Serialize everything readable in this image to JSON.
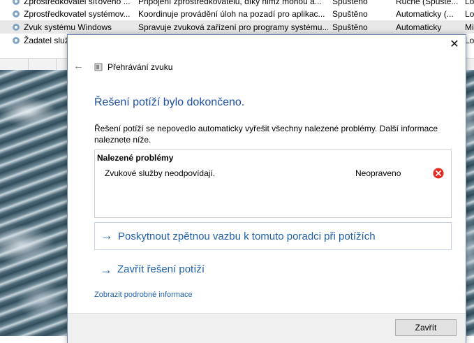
{
  "services": {
    "rows": [
      {
        "name": "Zprostředkovatel síťového ...",
        "description": "Připojení zprostředkovatelů, díky nimž mohou a...",
        "status": "Spuštěno",
        "startup": "Ručně (Spuště...",
        "logon": "Lo",
        "selected": false
      },
      {
        "name": "Zprostředkovatel systémov...",
        "description": "Koordinuje provádění úloh na pozadí pro aplikac...",
        "status": "Spuštěno",
        "startup": "Automaticky (...",
        "logon": "Lo",
        "selected": false
      },
      {
        "name": "Zvuk systému Windows",
        "description": "Spravuje zvuková zařízení pro programy systému...",
        "status": "Spuštěno",
        "startup": "Automaticky",
        "logon": "Mi",
        "selected": true
      },
      {
        "name": "Žadatel služ...",
        "description": "",
        "status": "",
        "startup": "",
        "logon": "Lo",
        "selected": false
      }
    ]
  },
  "dialog": {
    "close_glyph": "✕",
    "back_glyph": "←",
    "app_title": "Přehrávání zvuku",
    "heading": "Řešení potíží bylo dokončeno.",
    "description": "Řešení potíží se nepovedlo automaticky vyřešit všechny nalezené problémy. Další informace naleznete níže.",
    "problems": {
      "header": "Nalezené problémy",
      "items": [
        {
          "name": "Zvukové služby neodpovídají.",
          "status": "Neopraveno",
          "icon": "error-icon"
        }
      ]
    },
    "links": [
      {
        "arrow": "→",
        "label": "Poskytnout zpětnou vazbu k tomuto poradci při potížích"
      },
      {
        "arrow": "→",
        "label": "Zavřít řešení potíží"
      }
    ],
    "details_link": "Zobrazit podrobné informace",
    "close_button": "Zavřít"
  },
  "colors": {
    "link_blue": "#1f5fa8",
    "heading_blue": "#1c4fa0",
    "error_red": "#e02b20"
  }
}
